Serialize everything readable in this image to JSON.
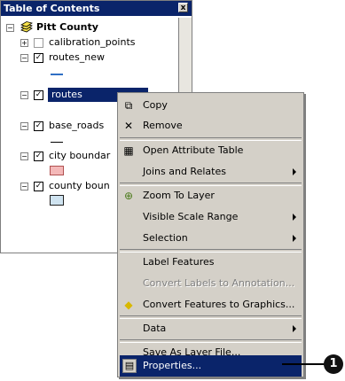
{
  "toc": {
    "title": "Table of Contents",
    "close_glyph": "x",
    "root_label": "Pitt County",
    "layers": [
      {
        "label": "calibration_points",
        "checked": false
      },
      {
        "label": "routes_new",
        "checked": true
      },
      {
        "label": "routes",
        "checked": true,
        "selected": true
      },
      {
        "label": "base_roads",
        "checked": true
      },
      {
        "label": "city boundar",
        "checked": true
      },
      {
        "label": "county boun",
        "checked": true
      }
    ]
  },
  "menu": {
    "items": [
      {
        "label": "Copy",
        "icon": "copy-icon",
        "glyph": "⧉"
      },
      {
        "label": "Remove",
        "icon": "remove-icon",
        "glyph": "✕"
      },
      {
        "label": "Open Attribute Table",
        "icon": "table-icon",
        "glyph": "▦"
      },
      {
        "label": "Joins and Relates",
        "submenu": true
      },
      {
        "label": "Zoom To Layer",
        "icon": "zoom-to-layer-icon",
        "glyph": "⊕"
      },
      {
        "label": "Visible Scale Range",
        "submenu": true
      },
      {
        "label": "Selection",
        "submenu": true
      },
      {
        "label": "Label Features"
      },
      {
        "label": "Convert Labels to Annotation...",
        "disabled": true
      },
      {
        "label": "Convert Features to Graphics...",
        "icon": "convert-graphics-icon",
        "glyph": "◆"
      },
      {
        "label": "Data",
        "submenu": true
      },
      {
        "label": "Save As Layer File..."
      },
      {
        "label": "Properties...",
        "icon": "properties-icon",
        "glyph": "▤",
        "selected": true
      }
    ]
  },
  "callout": {
    "number": "1"
  },
  "colors": {
    "title_bar": "#0a246a",
    "menu_bg": "#d4d0c8",
    "selection": "#0a246a",
    "city_fill": "#f4b8b8",
    "county_fill": "#cfe3f0",
    "route_line": "#2f6fc4"
  }
}
